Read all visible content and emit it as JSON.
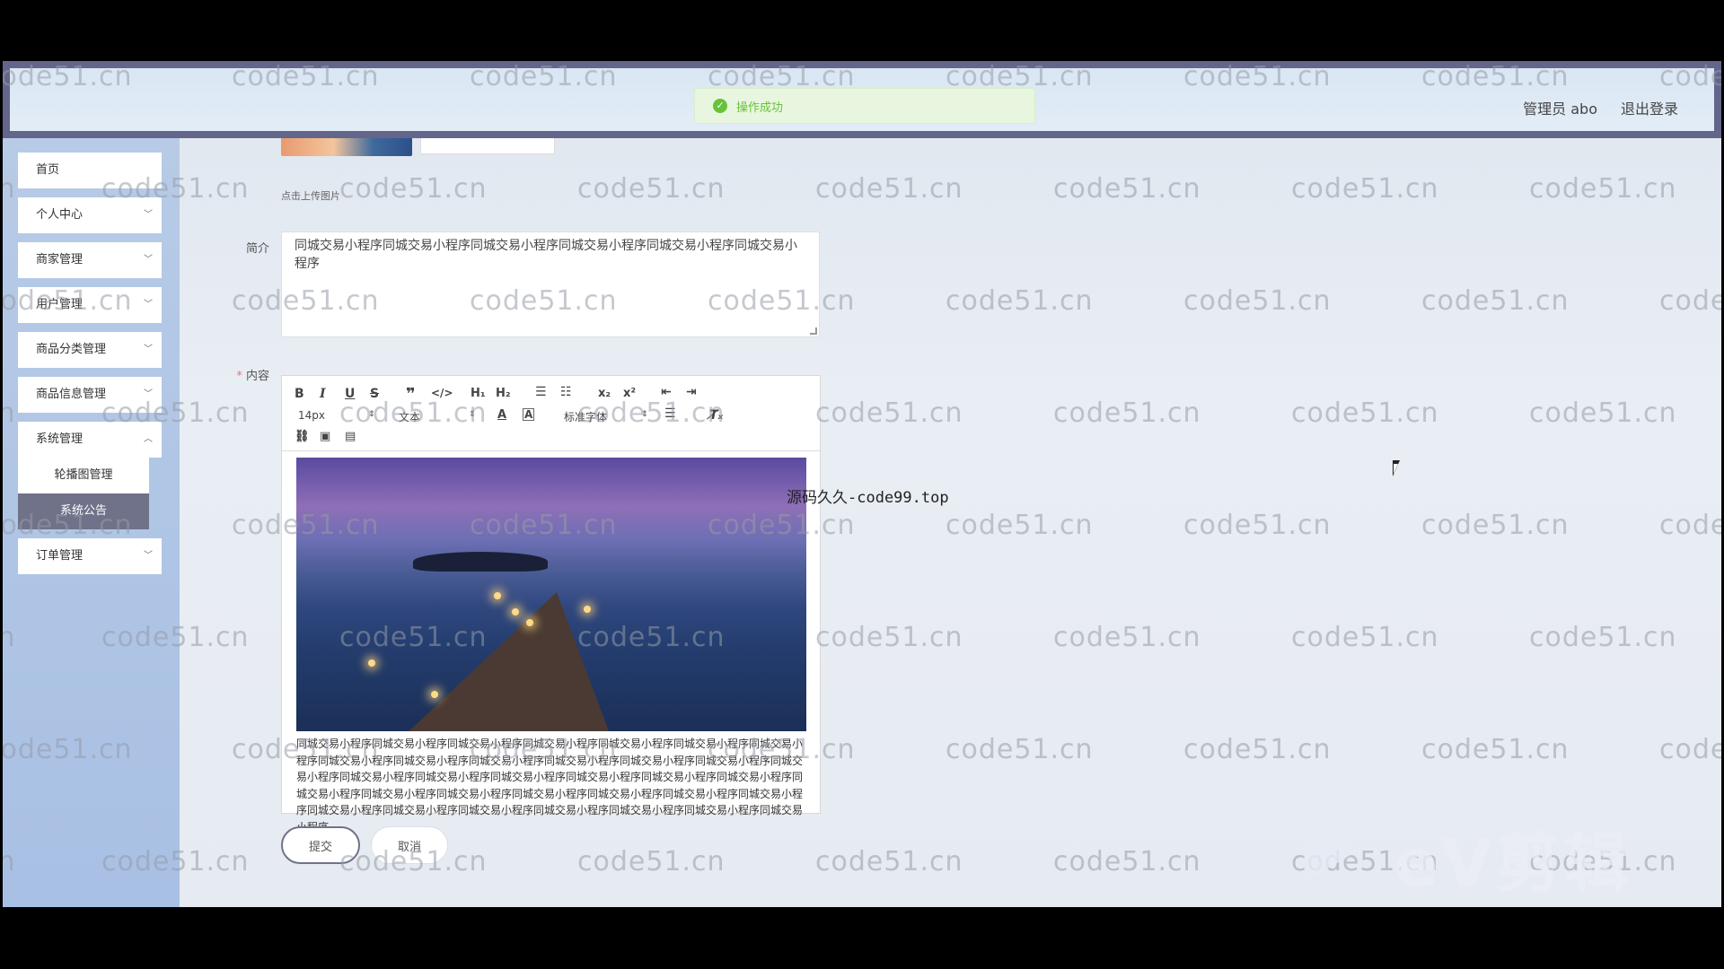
{
  "header": {
    "user_label": "管理员 abo",
    "logout_label": "退出登录"
  },
  "toast": {
    "message": "操作成功"
  },
  "sidebar": {
    "items": [
      {
        "label": "首页",
        "has_chevron": false
      },
      {
        "label": "个人中心",
        "has_chevron": true
      },
      {
        "label": "商家管理",
        "has_chevron": true
      },
      {
        "label": "用户管理",
        "has_chevron": true
      },
      {
        "label": "商品分类管理",
        "has_chevron": true
      },
      {
        "label": "商品信息管理",
        "has_chevron": true
      },
      {
        "label": "系统管理",
        "has_chevron": true
      },
      {
        "label": "订单管理",
        "has_chevron": true
      }
    ],
    "submenu": [
      {
        "label": "轮播图管理",
        "active": false
      },
      {
        "label": "系统公告",
        "active": true
      }
    ]
  },
  "form": {
    "upload_hint": "点击上传图片",
    "intro_label": "简介",
    "intro_value": "同城交易小程序同城交易小程序同城交易小程序同城交易小程序同城交易小程序同城交易小程序",
    "content_label": "内容",
    "content_required_mark": "*",
    "editor": {
      "font_size": "14px",
      "text_style": "文本",
      "font_family": "标准字体",
      "body_text": "同城交易小程序同城交易小程序同城交易小程序同城交易小程序同城交易小程序同城交易小程序同城交易小程序同城交易小程序同城交易小程序同城交易小程序同城交易小程序同城交易小程序同城交易小程序同城交易小程序同城交易小程序同城交易小程序同城交易小程序同城交易小程序同城交易小程序同城交易小程序同城交易小程序同城交易小程序同城交易小程序同城交易小程序同城交易小程序同城交易小程序同城交易小程序同城交易小程序同城交易小程序同城交易小程序同城交易小程序同城交易小程序同城交易小程序同城交易小程序"
    },
    "submit_label": "提交",
    "cancel_label": "取消"
  },
  "overlay": {
    "text": "源码久久-code99.top"
  },
  "watermark": {
    "text": "code51.cn"
  },
  "logo": {
    "text": "eV剪辑"
  },
  "colors": {
    "header_frame": "#63668a",
    "sidebar": "#a8c0e4",
    "active_submenu": "#6f7288",
    "toast_success": "#67c23a",
    "required": "#f56c6c"
  }
}
